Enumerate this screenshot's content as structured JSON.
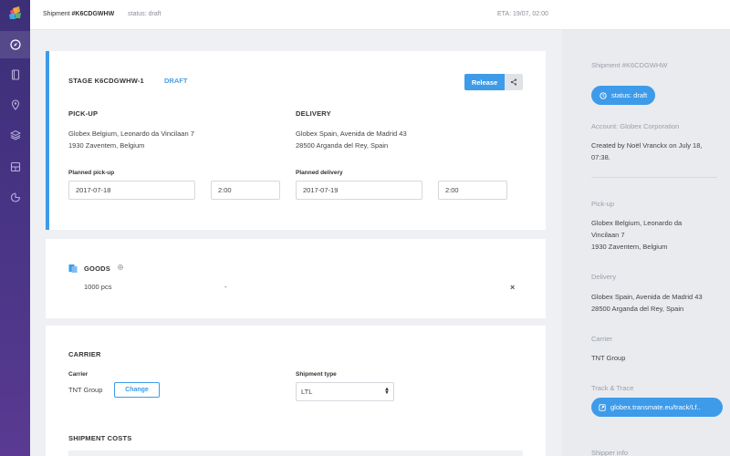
{
  "topbar": {
    "shipment_label": "Shipment",
    "shipment_id": "#K6CDGWHW",
    "status": "status: draft",
    "eta": "ETA: 19/07, 02:00"
  },
  "nav": {
    "items": [
      "compass-icon",
      "book-icon",
      "location-pin-icon",
      "layers-icon",
      "dashboard-icon",
      "pie-chart-icon"
    ]
  },
  "stage": {
    "title": "STAGE K6CDGWHW-1",
    "status": "DRAFT",
    "release_label": "Release",
    "pickup": {
      "heading": "PICK-UP",
      "address_line1": "Globex Belgium, Leonardo da Vincilaan 7",
      "address_line2": "1930 Zaventem, Belgium",
      "date_label": "Planned pick-up",
      "date": "2017-07-18",
      "time": "2:00"
    },
    "delivery": {
      "heading": "DELIVERY",
      "address_line1": "Globex Spain, Avenida de Madrid 43",
      "address_line2": "28500 Arganda del Rey, Spain",
      "date_label": "Planned delivery",
      "date": "2017-07-19",
      "time": "2:00"
    }
  },
  "goods": {
    "heading": "GOODS",
    "quantity": "1000 pcs",
    "description": "-",
    "remove": "×"
  },
  "carrier": {
    "heading": "CARRIER",
    "carrier_label": "Carrier",
    "carrier_value": "TNT Group",
    "change_label": "Change",
    "shipment_type_label": "Shipment type",
    "shipment_type_value": "LTL",
    "costs_heading": "SHIPMENT COSTS"
  },
  "sidebar": {
    "shipment_title": "Shipment #K6CDGWHW",
    "status_pill": "status: draft",
    "account": "Account: Globex Corporation",
    "created_line1": "Created by Noël Vranckx on July 18,",
    "created_line2": "07:38.",
    "pickup_label": "Pick-up",
    "pickup_line1": "Globex Belgium, Leonardo da",
    "pickup_line2": "Vincilaan 7",
    "pickup_line3": "1930 Zaventem, Belgium",
    "delivery_label": "Delivery",
    "delivery_line1": "Globex Spain, Avenida de Madrid 43",
    "delivery_line2": "28500 Arganda del Rey, Spain",
    "carrier_label": "Carrier",
    "carrier_value": "TNT Group",
    "track_label": "Track & Trace",
    "track_link": "globex.transmate.eu/track/Lf..",
    "shipper_label": "Shipper info"
  },
  "colors": {
    "accent": "#3d9be9",
    "nav_bg": "#3c2f78"
  }
}
